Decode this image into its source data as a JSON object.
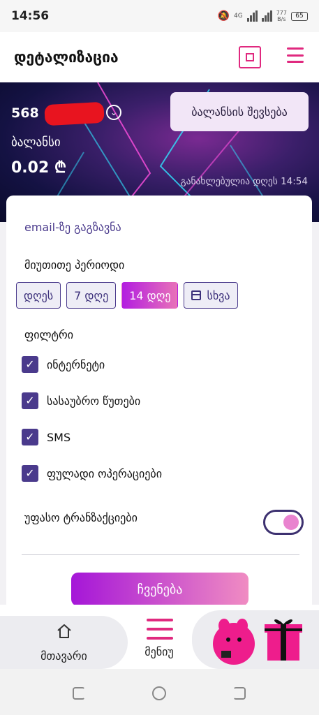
{
  "status": {
    "time": "14:56",
    "network": "4G",
    "speed_top": "777",
    "speed_bottom": "B/s",
    "battery": "65"
  },
  "header": {
    "title": "დეტალიზაცია"
  },
  "banner": {
    "number_prefix": "568",
    "balance_label": "ბალანსი",
    "balance_value": "0.02 ₾",
    "updated": "განახლებულია დღეს 14:54",
    "topup_label": "ბალანსის შევსება"
  },
  "card": {
    "email_link": "email-ზე გაგზავნა",
    "period_label": "მიუთითე პერიოდი",
    "periods": [
      "დღეს",
      "7 დღე",
      "14 დღე",
      "სხვა"
    ],
    "active_period": "14 დღე",
    "filter_label": "ფილტრი",
    "filters": [
      "ინტერნეტი",
      "სასაუბრო წუთები",
      "SMS",
      "ფულადი ოპერაციები"
    ],
    "free_label": "უფასო ტრანზაქციები",
    "free_toggle_on": true,
    "show_label": "ჩვენება"
  },
  "nav": {
    "home_label": "მთავარი",
    "menu_label": "მენიუ"
  },
  "colors": {
    "accent": "#e0297f",
    "primary": "#4a3a8c"
  }
}
